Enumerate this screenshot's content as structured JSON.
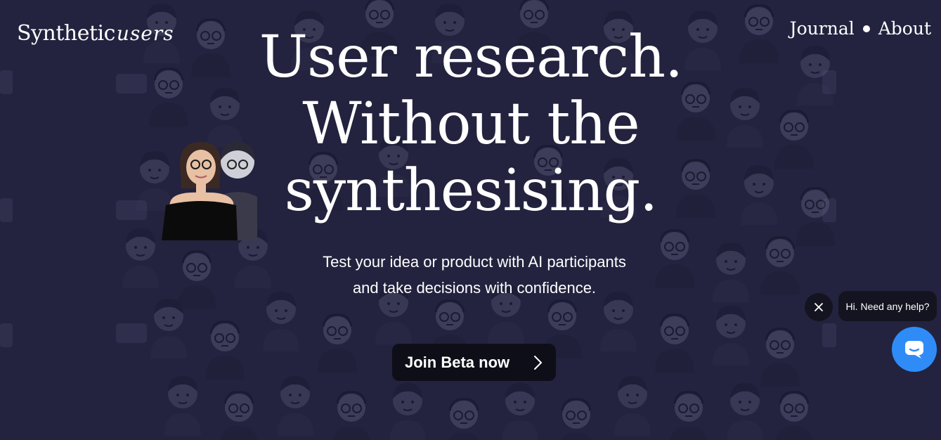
{
  "brand": {
    "logo_part1": "Synthetic",
    "logo_part2": "users"
  },
  "nav": {
    "journal": "Journal",
    "about": "About"
  },
  "hero": {
    "headline_line1": "User research.",
    "headline_line2": "Without the",
    "headline_line3": "synthesising.",
    "subtitle_line1": "Test your idea or product with AI participants",
    "subtitle_line2": "and take decisions with confidence."
  },
  "cta": {
    "label": "Join Beta now",
    "icon": "chevron-right-icon"
  },
  "chat_widget": {
    "greeting": "Hi. Need any help?",
    "close_icon": "close-icon",
    "launcher_icon": "chat-bubble-icon",
    "accent": "#2f8cf7"
  },
  "colors": {
    "background": "#23233f",
    "button": "#0e0e18"
  }
}
